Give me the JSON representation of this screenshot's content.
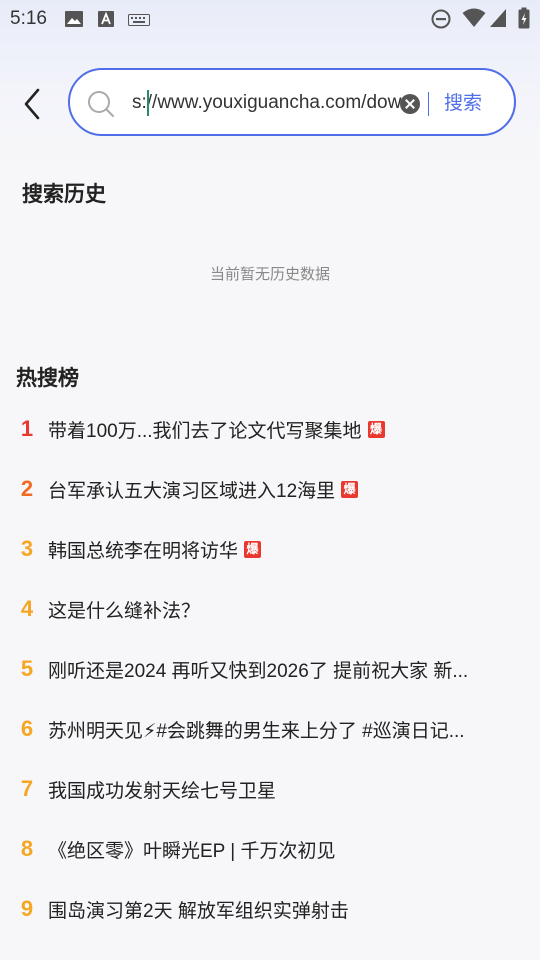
{
  "status_bar": {
    "time": "5:16",
    "left_icons": [
      "image-icon",
      "text-a-icon",
      "keyboard-icon"
    ],
    "right_icons": [
      "do-not-disturb-icon",
      "wifi-icon",
      "cellular-icon",
      "battery-icon"
    ]
  },
  "search": {
    "value": "s://www.youxiguancha.com/dow",
    "button_label": "搜索"
  },
  "history": {
    "title": "搜索历史",
    "empty_text": "当前暂无历史数据"
  },
  "hot": {
    "title": "热搜榜",
    "items": [
      {
        "rank": "1",
        "text": "带着100万...我们去了论文代写聚集地",
        "badge": "爆",
        "rank_color": "#e8382f"
      },
      {
        "rank": "2",
        "text": "台军承认五大演习区域进入12海里",
        "badge": "爆",
        "rank_color": "#f26a21"
      },
      {
        "rank": "3",
        "text": "韩国总统李在明将访华",
        "badge": "爆",
        "rank_color": "#f5a623"
      },
      {
        "rank": "4",
        "text": "这是什么缝补法？",
        "badge": "",
        "rank_color": "#f5a623"
      },
      {
        "rank": "5",
        "text": "刚听还是2024 再听又快到2026了 提前祝大家 新...",
        "badge": "",
        "rank_color": "#f5a623"
      },
      {
        "rank": "6",
        "text": "苏州明天见⚡#会跳舞的男生来上分了 #巡演日记...",
        "badge": "",
        "rank_color": "#f5a623"
      },
      {
        "rank": "7",
        "text": "我国成功发射天绘七号卫星",
        "badge": "",
        "rank_color": "#f5a623"
      },
      {
        "rank": "8",
        "text": "《绝区零》叶瞬光EP | 千万次初见",
        "badge": "",
        "rank_color": "#f5a623"
      },
      {
        "rank": "9",
        "text": "围岛演习第2天 解放军组织实弹射击",
        "badge": "",
        "rank_color": "#f5a623"
      }
    ]
  },
  "colors": {
    "accent": "#4f6ee8",
    "rank_top": "#e8382f",
    "rank_second": "#f26a21",
    "rank_other": "#f5a623",
    "badge_bg": "#e8382f"
  }
}
